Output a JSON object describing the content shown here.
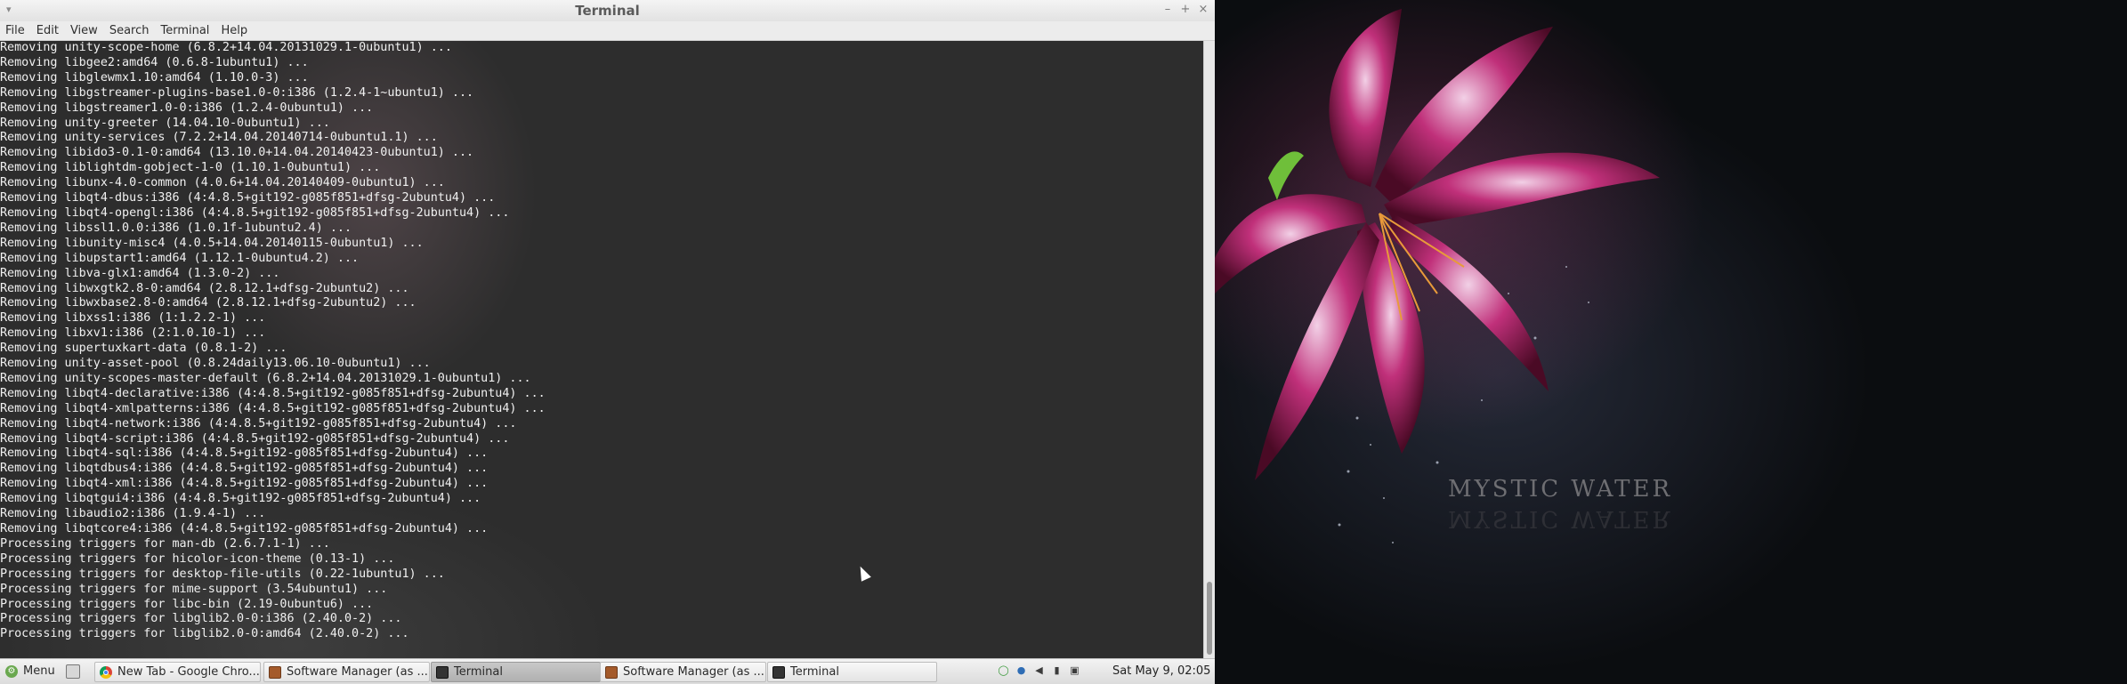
{
  "window": {
    "title": "Terminal",
    "menu": [
      "File",
      "Edit",
      "View",
      "Search",
      "Terminal",
      "Help"
    ]
  },
  "terminal": {
    "lines": [
      "Removing unity-scope-home (6.8.2+14.04.20131029.1-0ubuntu1) ...",
      "Removing libgee2:amd64 (0.6.8-1ubuntu1) ...",
      "Removing libglewmx1.10:amd64 (1.10.0-3) ...",
      "Removing libgstreamer-plugins-base1.0-0:i386 (1.2.4-1~ubuntu1) ...",
      "Removing libgstreamer1.0-0:i386 (1.2.4-0ubuntu1) ...",
      "Removing unity-greeter (14.04.10-0ubuntu1) ...",
      "Removing unity-services (7.2.2+14.04.20140714-0ubuntu1.1) ...",
      "Removing libido3-0.1-0:amd64 (13.10.0+14.04.20140423-0ubuntu1) ...",
      "Removing liblightdm-gobject-1-0 (1.10.1-0ubuntu1) ...",
      "Removing libunx-4.0-common (4.0.6+14.04.20140409-0ubuntu1) ...",
      "Removing libqt4-dbus:i386 (4:4.8.5+git192-g085f851+dfsg-2ubuntu4) ...",
      "Removing libqt4-opengl:i386 (4:4.8.5+git192-g085f851+dfsg-2ubuntu4) ...",
      "Removing libssl1.0.0:i386 (1.0.1f-1ubuntu2.4) ...",
      "Removing libunity-misc4 (4.0.5+14.04.20140115-0ubuntu1) ...",
      "Removing libupstart1:amd64 (1.12.1-0ubuntu4.2) ...",
      "Removing libva-glx1:amd64 (1.3.0-2) ...",
      "Removing libwxgtk2.8-0:amd64 (2.8.12.1+dfsg-2ubuntu2) ...",
      "Removing libwxbase2.8-0:amd64 (2.8.12.1+dfsg-2ubuntu2) ...",
      "Removing libxss1:i386 (1:1.2.2-1) ...",
      "Removing libxv1:i386 (2:1.0.10-1) ...",
      "Removing supertuxkart-data (0.8.1-2) ...",
      "Removing unity-asset-pool (0.8.24daily13.06.10-0ubuntu1) ...",
      "Removing unity-scopes-master-default (6.8.2+14.04.20131029.1-0ubuntu1) ...",
      "Removing libqt4-declarative:i386 (4:4.8.5+git192-g085f851+dfsg-2ubuntu4) ...",
      "Removing libqt4-xmlpatterns:i386 (4:4.8.5+git192-g085f851+dfsg-2ubuntu4) ...",
      "Removing libqt4-network:i386 (4:4.8.5+git192-g085f851+dfsg-2ubuntu4) ...",
      "Removing libqt4-script:i386 (4:4.8.5+git192-g085f851+dfsg-2ubuntu4) ...",
      "Removing libqt4-sql:i386 (4:4.8.5+git192-g085f851+dfsg-2ubuntu4) ...",
      "Removing libqtdbus4:i386 (4:4.8.5+git192-g085f851+dfsg-2ubuntu4) ...",
      "Removing libqt4-xml:i386 (4:4.8.5+git192-g085f851+dfsg-2ubuntu4) ...",
      "Removing libqtgui4:i386 (4:4.8.5+git192-g085f851+dfsg-2ubuntu4) ...",
      "Removing libaudio2:i386 (1.9.4-1) ...",
      "Removing libqtcore4:i386 (4:4.8.5+git192-g085f851+dfsg-2ubuntu4) ...",
      "Processing triggers for man-db (2.6.7.1-1) ...",
      "Processing triggers for hicolor-icon-theme (0.13-1) ...",
      "Processing triggers for desktop-file-utils (0.22-1ubuntu1) ...",
      "Processing triggers for mime-support (3.54ubuntu1) ...",
      "Processing triggers for libc-bin (2.19-0ubuntu6) ...",
      "Processing triggers for libglib2.0-0:i386 (2.40.0-2) ...",
      "Processing triggers for libglib2.0-0:amd64 (2.40.0-2) ..."
    ]
  },
  "desktop": {
    "watermark": "MYSTIC WATER"
  },
  "taskbar": {
    "menu_label": "Menu",
    "tasks": [
      {
        "label": "New Tab - Google Chro...",
        "icon": "chrome-icon",
        "active": false
      },
      {
        "label": "Software Manager (as ...",
        "icon": "software-manager-icon",
        "active": false
      },
      {
        "label": "Terminal",
        "icon": "terminal-icon",
        "active": true
      },
      {
        "label": "Software Manager (as ...",
        "icon": "software-manager-icon",
        "active": false
      },
      {
        "label": "Terminal",
        "icon": "terminal-icon",
        "active": false
      }
    ],
    "tray_icons": [
      "network-manager-icon",
      "update-shield-icon",
      "volume-muted-icon",
      "signal-icon",
      "user-icon"
    ],
    "clock": "Sat May  9, 02:05"
  }
}
